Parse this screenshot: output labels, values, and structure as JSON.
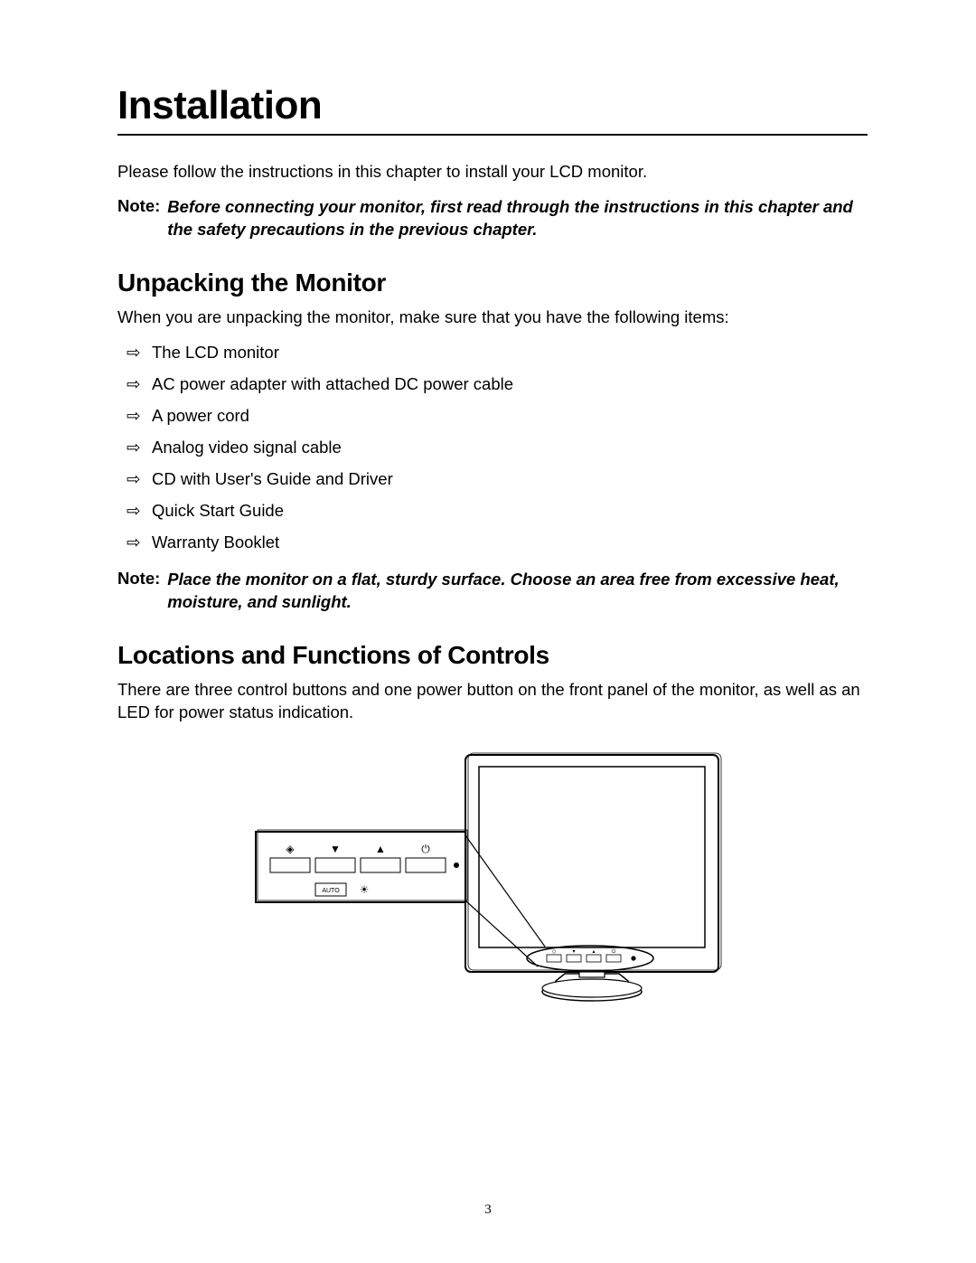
{
  "title": "Installation",
  "intro": "Please follow the instructions in this chapter to install your LCD monitor.",
  "note1_label": "Note:",
  "note1_body": "Before connecting your monitor, first read through the instructions in this chapter and the safety precautions in the previous chapter.",
  "section_unpacking": "Unpacking the Monitor",
  "unpacking_intro": "When you are unpacking the monitor, make sure that you have the following items:",
  "unpacking_items": [
    "The LCD monitor",
    "AC power adapter with attached DC power cable",
    "A power cord",
    "Analog video signal cable",
    "CD with User's Guide and Driver",
    "Quick Start Guide",
    "Warranty Booklet"
  ],
  "note2_label": "Note:",
  "note2_body": "Place the monitor on a flat, sturdy surface. Choose an area free from excessive heat, moisture, and sunlight.",
  "section_controls": "Locations and Functions of Controls",
  "controls_intro": "There are three control buttons and one power button on the front panel of the monitor, as well as an LED for power status indication.",
  "figure": {
    "callout_auto": "AUTO",
    "icon_menu": "◈",
    "icon_down": "▼",
    "icon_up": "▲",
    "icon_power": "⏻",
    "icon_bright": "☀"
  },
  "page_number": "3"
}
